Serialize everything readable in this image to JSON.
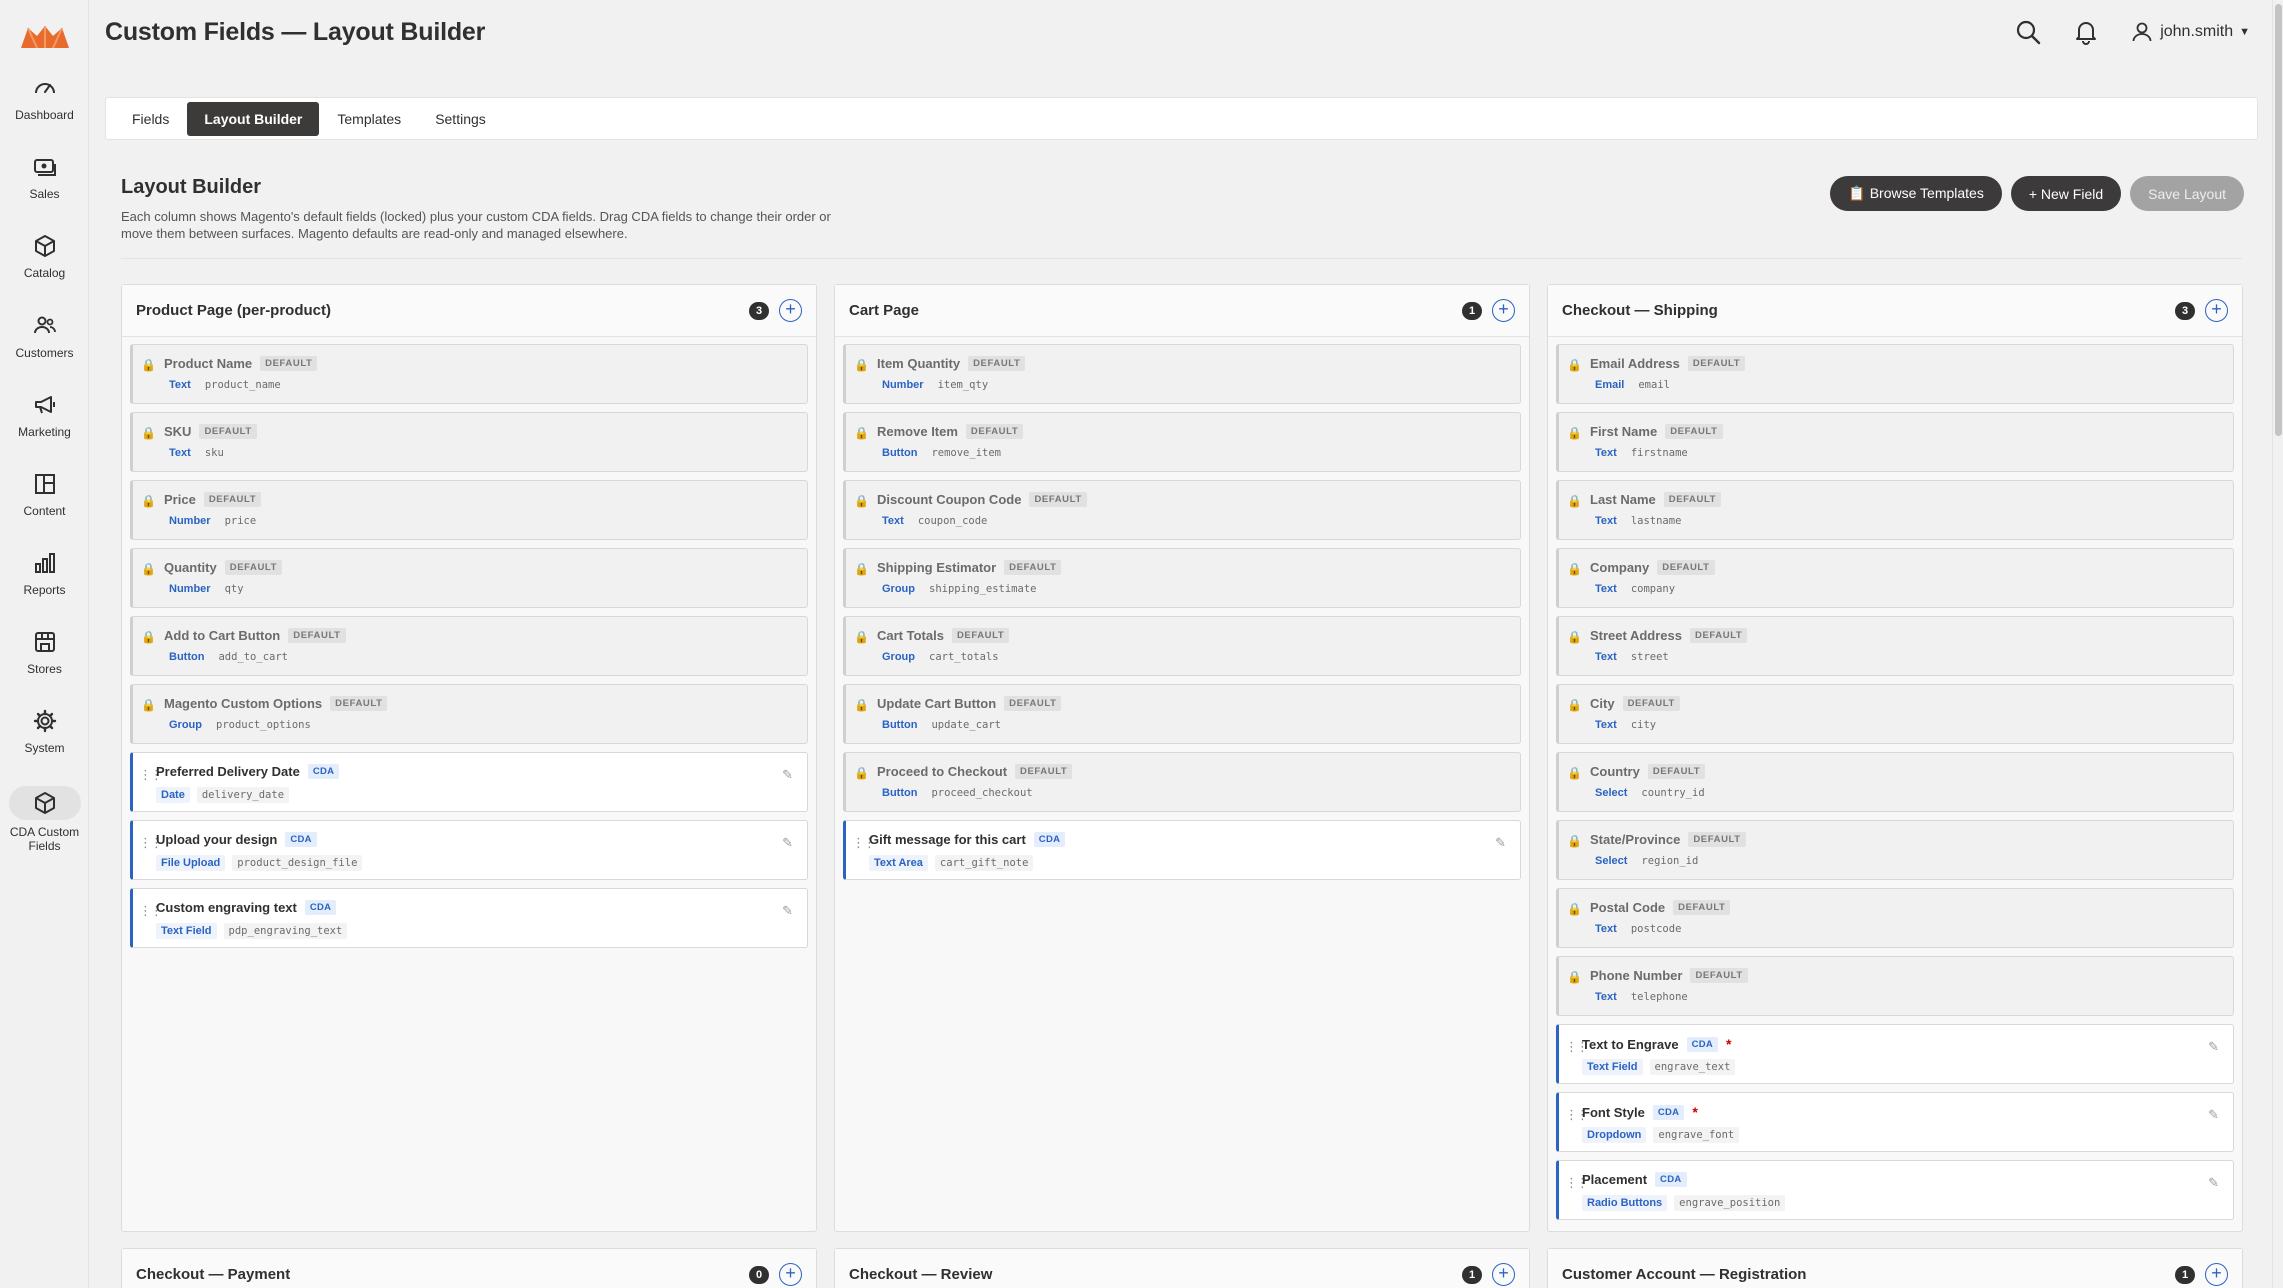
{
  "colors": {
    "accent": "#2b63c2",
    "dark": "#3c3a3a",
    "brand_logo": "#e86a2c"
  },
  "sidebar": {
    "items": [
      {
        "label": "Dashboard",
        "icon": "speedometer-icon"
      },
      {
        "label": "Sales",
        "icon": "money-icon"
      },
      {
        "label": "Catalog",
        "icon": "cube-icon"
      },
      {
        "label": "Customers",
        "icon": "people-icon"
      },
      {
        "label": "Marketing",
        "icon": "megaphone-icon"
      },
      {
        "label": "Content",
        "icon": "layout-icon"
      },
      {
        "label": "Reports",
        "icon": "bar-chart-icon"
      },
      {
        "label": "Stores",
        "icon": "store-icon"
      },
      {
        "label": "System",
        "icon": "gear-icon"
      },
      {
        "label": "CDA Custom Fields",
        "icon": "cube-icon",
        "active": true
      }
    ]
  },
  "header": {
    "title": "Custom Fields — Layout Builder",
    "username": "john.smith"
  },
  "tabs": [
    "Fields",
    "Layout Builder",
    "Templates",
    "Settings"
  ],
  "active_tab": "Layout Builder",
  "builder": {
    "title": "Layout Builder",
    "description": "Each column shows Magento's default fields (locked) plus your custom CDA fields. Drag CDA fields to change their order or move them between surfaces. Magento defaults are read-only and managed elsewhere.",
    "browse_label": "📋 Browse Templates",
    "new_field_label": "+ New Field",
    "save_label": "Save Layout"
  },
  "columns": [
    {
      "title": "Product Page (per-product)",
      "count": "3",
      "cards": [
        {
          "name": "Product Name",
          "tag": "DEFAULT",
          "type": "Text",
          "code": "product_name",
          "locked": true
        },
        {
          "name": "SKU",
          "tag": "DEFAULT",
          "type": "Text",
          "code": "sku",
          "locked": true
        },
        {
          "name": "Price",
          "tag": "DEFAULT",
          "type": "Number",
          "code": "price",
          "locked": true
        },
        {
          "name": "Quantity",
          "tag": "DEFAULT",
          "type": "Number",
          "code": "qty",
          "locked": true
        },
        {
          "name": "Add to Cart Button",
          "tag": "DEFAULT",
          "type": "Button",
          "code": "add_to_cart",
          "locked": true
        },
        {
          "name": "Magento Custom Options",
          "tag": "DEFAULT",
          "type": "Group",
          "code": "product_options",
          "locked": true
        },
        {
          "name": "Preferred Delivery Date",
          "tag": "CDA",
          "type": "Date",
          "code": "delivery_date",
          "locked": false
        },
        {
          "name": "Upload your design",
          "tag": "CDA",
          "type": "File Upload",
          "code": "product_design_file",
          "locked": false
        },
        {
          "name": "Custom engraving text",
          "tag": "CDA",
          "type": "Text Field",
          "code": "pdp_engraving_text",
          "locked": false
        }
      ]
    },
    {
      "title": "Cart Page",
      "count": "1",
      "cards": [
        {
          "name": "Item Quantity",
          "tag": "DEFAULT",
          "type": "Number",
          "code": "item_qty",
          "locked": true
        },
        {
          "name": "Remove Item",
          "tag": "DEFAULT",
          "type": "Button",
          "code": "remove_item",
          "locked": true
        },
        {
          "name": "Discount Coupon Code",
          "tag": "DEFAULT",
          "type": "Text",
          "code": "coupon_code",
          "locked": true
        },
        {
          "name": "Shipping Estimator",
          "tag": "DEFAULT",
          "type": "Group",
          "code": "shipping_estimate",
          "locked": true
        },
        {
          "name": "Cart Totals",
          "tag": "DEFAULT",
          "type": "Group",
          "code": "cart_totals",
          "locked": true
        },
        {
          "name": "Update Cart Button",
          "tag": "DEFAULT",
          "type": "Button",
          "code": "update_cart",
          "locked": true
        },
        {
          "name": "Proceed to Checkout",
          "tag": "DEFAULT",
          "type": "Button",
          "code": "proceed_checkout",
          "locked": true
        },
        {
          "name": "Gift message for this cart",
          "tag": "CDA",
          "type": "Text Area",
          "code": "cart_gift_note",
          "locked": false
        }
      ]
    },
    {
      "title": "Checkout — Shipping",
      "count": "3",
      "cards": [
        {
          "name": "Email Address",
          "tag": "DEFAULT",
          "type": "Email",
          "code": "email",
          "locked": true
        },
        {
          "name": "First Name",
          "tag": "DEFAULT",
          "type": "Text",
          "code": "firstname",
          "locked": true
        },
        {
          "name": "Last Name",
          "tag": "DEFAULT",
          "type": "Text",
          "code": "lastname",
          "locked": true
        },
        {
          "name": "Company",
          "tag": "DEFAULT",
          "type": "Text",
          "code": "company",
          "locked": true
        },
        {
          "name": "Street Address",
          "tag": "DEFAULT",
          "type": "Text",
          "code": "street",
          "locked": true
        },
        {
          "name": "City",
          "tag": "DEFAULT",
          "type": "Text",
          "code": "city",
          "locked": true
        },
        {
          "name": "Country",
          "tag": "DEFAULT",
          "type": "Select",
          "code": "country_id",
          "locked": true
        },
        {
          "name": "State/Province",
          "tag": "DEFAULT",
          "type": "Select",
          "code": "region_id",
          "locked": true
        },
        {
          "name": "Postal Code",
          "tag": "DEFAULT",
          "type": "Text",
          "code": "postcode",
          "locked": true
        },
        {
          "name": "Phone Number",
          "tag": "DEFAULT",
          "type": "Text",
          "code": "telephone",
          "locked": true
        },
        {
          "name": "Text to Engrave",
          "tag": "CDA",
          "type": "Text Field",
          "code": "engrave_text",
          "locked": false,
          "required": "*"
        },
        {
          "name": "Font Style",
          "tag": "CDA",
          "type": "Dropdown",
          "code": "engrave_font",
          "locked": false,
          "required": "*"
        },
        {
          "name": "Placement",
          "tag": "CDA",
          "type": "Radio Buttons",
          "code": "engrave_position",
          "locked": false
        }
      ]
    },
    {
      "title": "Checkout — Payment",
      "count": "0",
      "cards": []
    },
    {
      "title": "Checkout — Review",
      "count": "1",
      "cards": []
    },
    {
      "title": "Customer Account — Registration",
      "count": "1",
      "cards": []
    }
  ]
}
